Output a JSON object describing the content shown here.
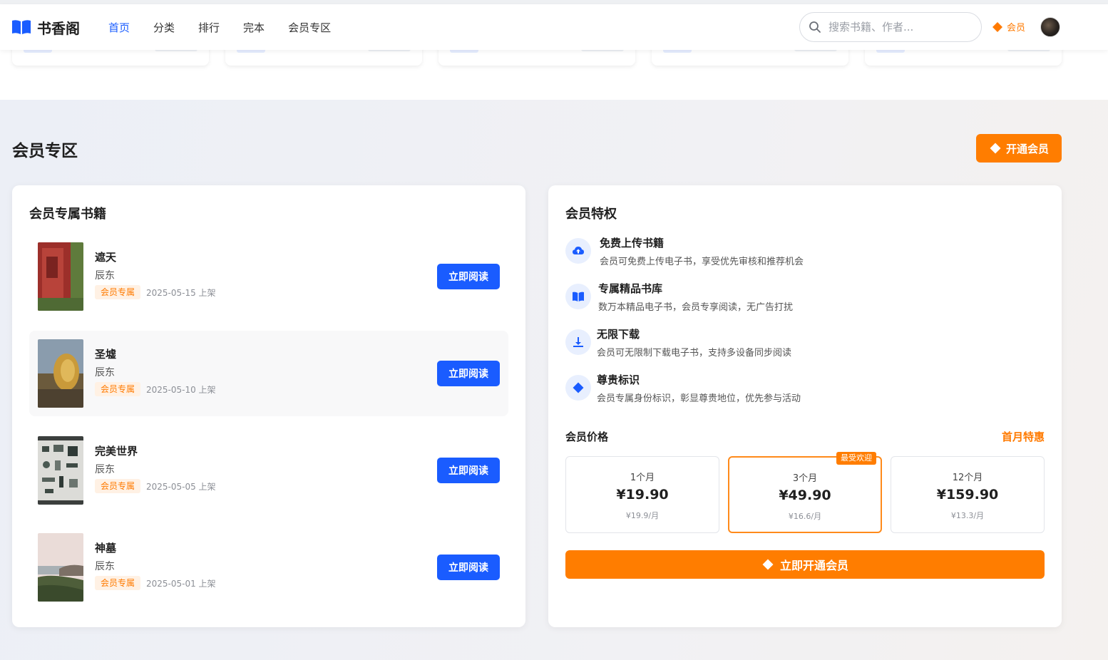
{
  "header": {
    "logo_text": "书香阁",
    "nav": [
      "首页",
      "分类",
      "排行",
      "完本",
      "会员专区"
    ],
    "active_nav": "首页",
    "search_placeholder": "搜索书籍、作者...",
    "member_label": "会员"
  },
  "section": {
    "title": "会员专区",
    "open_button": "开通会员"
  },
  "books_panel": {
    "title": "会员专属书籍",
    "read_label": "立即阅读",
    "books": [
      {
        "title": "遮天",
        "author": "辰东",
        "tag": "会员专属",
        "date": "2025-05-15 上架",
        "cover_icon": "red-wall-cover"
      },
      {
        "title": "圣墟",
        "author": "辰东",
        "tag": "会员专属",
        "date": "2025-05-10 上架",
        "cover_icon": "plant-macro-cover"
      },
      {
        "title": "完美世界",
        "author": "辰东",
        "tag": "会员专属",
        "date": "2025-05-05 上架",
        "cover_icon": "flatlay-items-cover"
      },
      {
        "title": "神墓",
        "author": "辰东",
        "tag": "会员专属",
        "date": "2025-05-01 上架",
        "cover_icon": "seaside-cover"
      }
    ]
  },
  "privileges_panel": {
    "title": "会员特权",
    "items": [
      {
        "title": "免费上传书籍",
        "desc": "会员可免费上传电子书，享受优先审核和推荐机会",
        "icon": "cloud-upload-icon"
      },
      {
        "title": "专属精品书库",
        "desc": "数万本精品电子书，会员专享阅读，无广告打扰",
        "icon": "open-book-icon"
      },
      {
        "title": "无限下载",
        "desc": "会员可无限制下载电子书，支持多设备同步阅读",
        "icon": "download-icon"
      },
      {
        "title": "尊贵标识",
        "desc": "会员专属身份标识，彰显尊贵地位，优先参与活动",
        "icon": "diamond-icon"
      }
    ],
    "price_title": "会员价格",
    "price_promo": "首月特惠",
    "plans": [
      {
        "name": "1个月",
        "price": "¥19.90",
        "monthly": "¥19.9/月",
        "badge": ""
      },
      {
        "name": "3个月",
        "price": "¥49.90",
        "monthly": "¥16.6/月",
        "badge": "最受欢迎",
        "selected": true
      },
      {
        "name": "12个月",
        "price": "¥159.90",
        "monthly": "¥13.3/月",
        "badge": ""
      }
    ],
    "cta": "立即开通会员"
  },
  "colors": {
    "primary": "#1a5cff",
    "accent": "#ff7d00"
  }
}
